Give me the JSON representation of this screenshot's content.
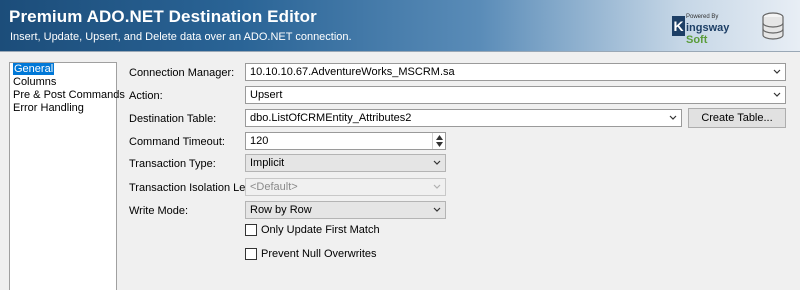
{
  "header": {
    "title": "Premium ADO.NET Destination Editor",
    "subtitle": "Insert, Update, Upsert, and Delete data over an ADO.NET connection.",
    "logo_small": "Powered By",
    "logo_k": "K",
    "logo_name": "ingsway",
    "logo_soft": "Soft"
  },
  "nav": {
    "items": [
      {
        "label": "General",
        "selected": true
      },
      {
        "label": "Columns"
      },
      {
        "label": "Pre & Post Commands"
      },
      {
        "label": "Error Handling"
      }
    ]
  },
  "form": {
    "connection_manager": {
      "label": "Connection Manager:",
      "value": "10.10.10.67.AdventureWorks_MSCRM.sa"
    },
    "action": {
      "label": "Action:",
      "value": "Upsert"
    },
    "destination_table": {
      "label": "Destination Table:",
      "value": "dbo.ListOfCRMEntity_Attributes2",
      "button": "Create Table..."
    },
    "command_timeout": {
      "label": "Command Timeout:",
      "value": "120"
    },
    "transaction_type": {
      "label": "Transaction Type:",
      "value": "Implicit"
    },
    "isolation_level": {
      "label": "Transaction Isolation Level:",
      "value": "<Default>"
    },
    "write_mode": {
      "label": "Write Mode:",
      "value": "Row by Row"
    },
    "only_update_first_match": {
      "label": "Only Update First Match",
      "checked": false
    },
    "prevent_null_overwrites": {
      "label": "Prevent Null Overwrites",
      "checked": false
    }
  }
}
